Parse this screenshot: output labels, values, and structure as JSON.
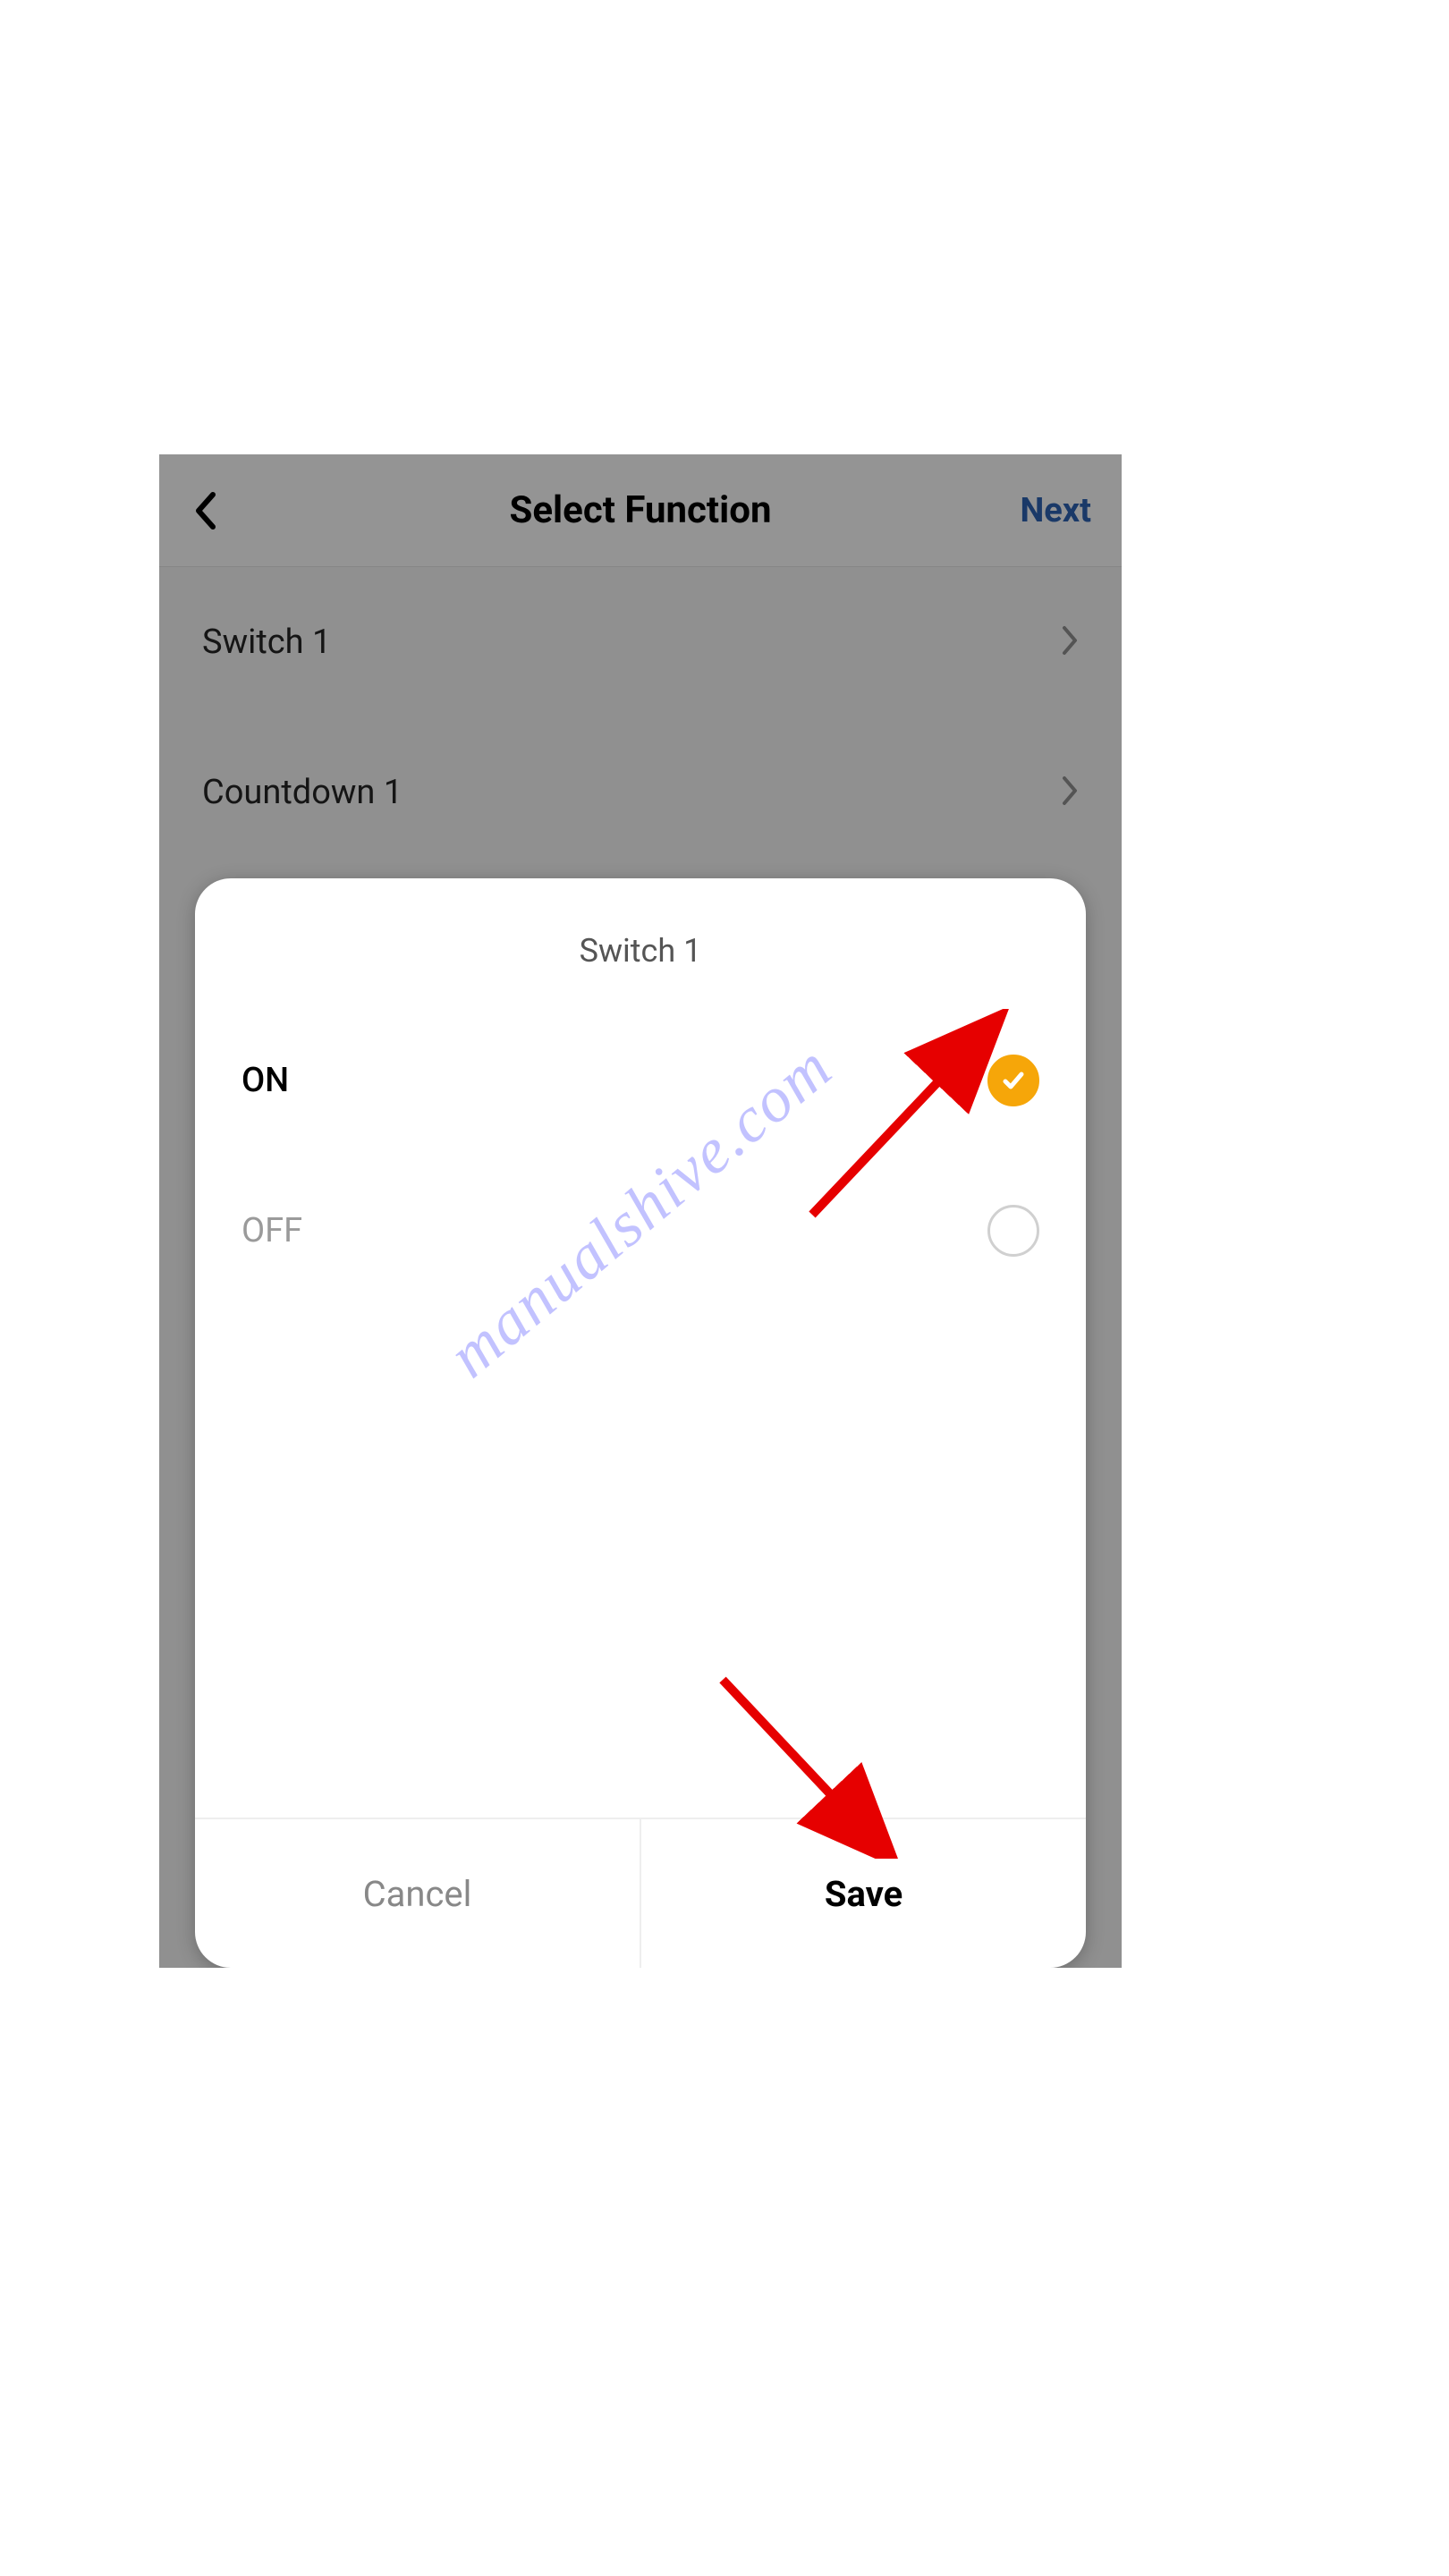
{
  "header": {
    "title": "Select Function",
    "next_label": "Next"
  },
  "list": {
    "items": [
      {
        "label": "Switch 1"
      },
      {
        "label": "Countdown 1"
      }
    ]
  },
  "modal": {
    "title": "Switch 1",
    "options": [
      {
        "label": "ON",
        "selected": true
      },
      {
        "label": "OFF",
        "selected": false
      }
    ],
    "cancel_label": "Cancel",
    "save_label": "Save"
  },
  "watermark": "manualshive.com",
  "colors": {
    "accent": "#f6a609",
    "next_link": "#2a5da8",
    "arrow": "#e60000"
  }
}
